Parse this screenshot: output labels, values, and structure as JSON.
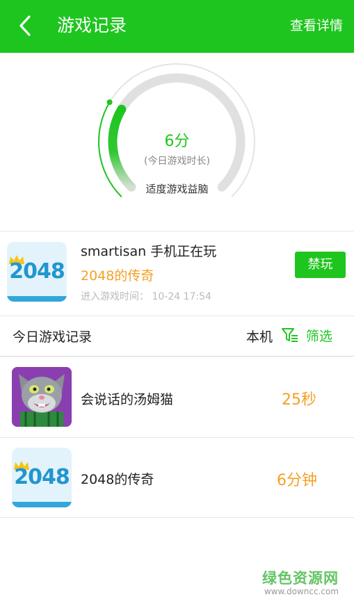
{
  "header": {
    "title": "游戏记录",
    "detail_link": "查看详情"
  },
  "gauge": {
    "value": "6分",
    "caption": "(今日游戏时长)",
    "tip": "适度游戏益脑",
    "progress": 0.28,
    "accent": "#1ec51e",
    "track": "#e0e0e0"
  },
  "current": {
    "device_status": "smartisan 手机正在玩",
    "game": "2048的传奇",
    "entered": "进入游戏时间：  10-24 17:54",
    "icon_text": "2048",
    "ban_button": "禁玩"
  },
  "records": {
    "title": "今日游戏记录",
    "device": "本机",
    "filter": "筛选",
    "items": [
      {
        "name": "会说话的汤姆猫",
        "duration": "25秒"
      },
      {
        "name": "2048的传奇",
        "duration": "6分钟",
        "icon_text": "2048"
      }
    ]
  },
  "watermark": {
    "name": "绿色资源网",
    "url": "www.downcc.com"
  }
}
